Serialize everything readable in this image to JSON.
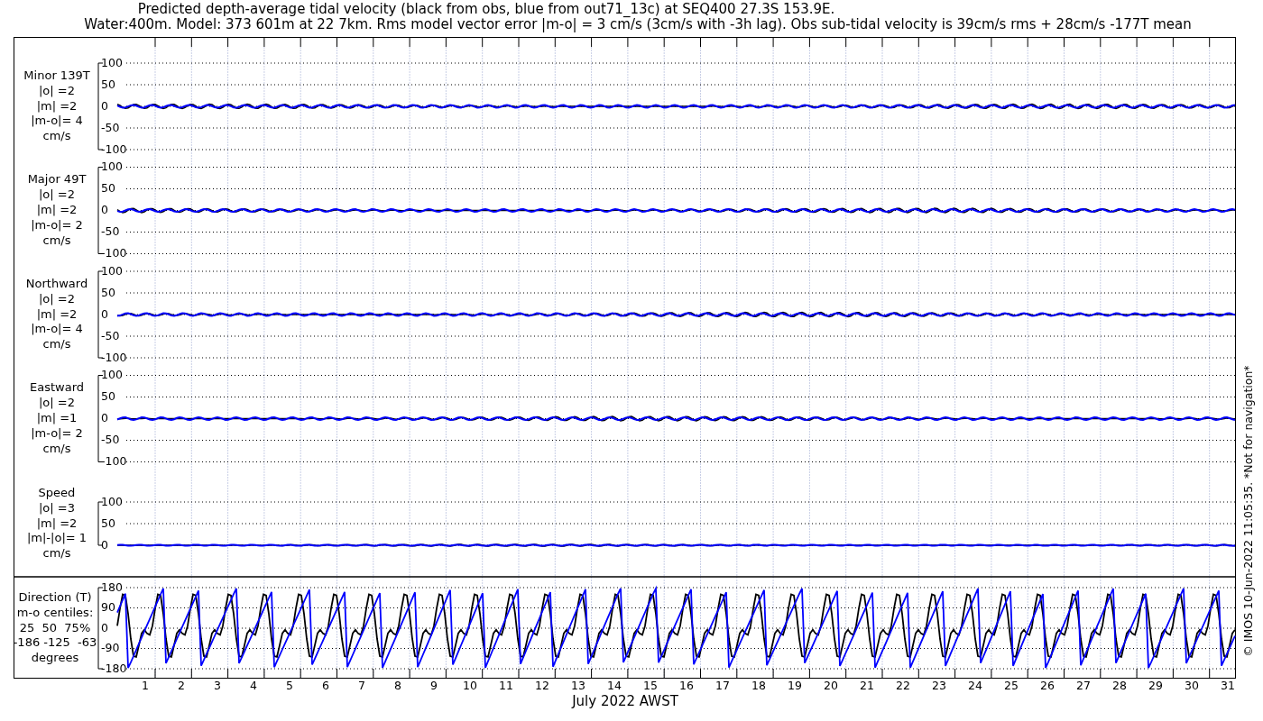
{
  "title_lines": [
    "Predicted depth-average tidal velocity (black from obs, blue from out71_13c) at SEQ400 27.3S 153.9E.",
    "Water:400m. Model: 373 601m at 22 7km. Rms model vector error |m-o| = 3 cm/s (3cm/s with -3h lag). Obs sub-tidal velocity is 39cm/s rms + 28cm/s -177T mean"
  ],
  "panels": [
    {
      "kind": "signed",
      "label_lines": [
        "Minor 139T",
        "|o| =2",
        "|m| =2",
        "|m-o|= 4",
        "cm/s"
      ],
      "yticks": [
        "100",
        "50",
        "0",
        "-50",
        "-100"
      ]
    },
    {
      "kind": "signed",
      "label_lines": [
        "Major 49T",
        "|o| =2",
        "|m| =2",
        "|m-o|= 2",
        "cm/s"
      ],
      "yticks": [
        "100",
        "50",
        "0",
        "-50",
        "-100"
      ]
    },
    {
      "kind": "signed",
      "label_lines": [
        "Northward",
        "|o| =2",
        "|m| =2",
        "|m-o|= 4",
        "cm/s"
      ],
      "yticks": [
        "100",
        "50",
        "0",
        "-50",
        "-100"
      ]
    },
    {
      "kind": "signed",
      "label_lines": [
        "Eastward",
        "|o| =2",
        "|m| =1",
        "|m-o|= 2",
        "cm/s"
      ],
      "yticks": [
        "100",
        "50",
        "0",
        "-50",
        "-100"
      ]
    },
    {
      "kind": "speed",
      "label_lines": [
        "Speed",
        "|o| =3",
        "|m| =2",
        "|m|-|o|= 1",
        "cm/s"
      ],
      "yticks": [
        "100",
        "50",
        "0"
      ]
    },
    {
      "kind": "direction",
      "label_lines": [
        "Direction (T)",
        "m-o centiles:",
        "25  50  75%",
        "-186 -125  -63",
        "degrees"
      ],
      "yticks": [
        "180",
        "90",
        "0",
        "-90",
        "-180"
      ]
    }
  ],
  "xticks": [
    "1",
    "2",
    "3",
    "4",
    "5",
    "6",
    "7",
    "8",
    "9",
    "10",
    "11",
    "12",
    "13",
    "14",
    "15",
    "16",
    "17",
    "18",
    "19",
    "20",
    "21",
    "22",
    "23",
    "24",
    "25",
    "26",
    "27",
    "28",
    "29",
    "30",
    "31"
  ],
  "xlabel": "July 2022 AWST",
  "footer_note": "© IMOS 10-Jun-2022 11:05:35. *Not for navigation*"
}
